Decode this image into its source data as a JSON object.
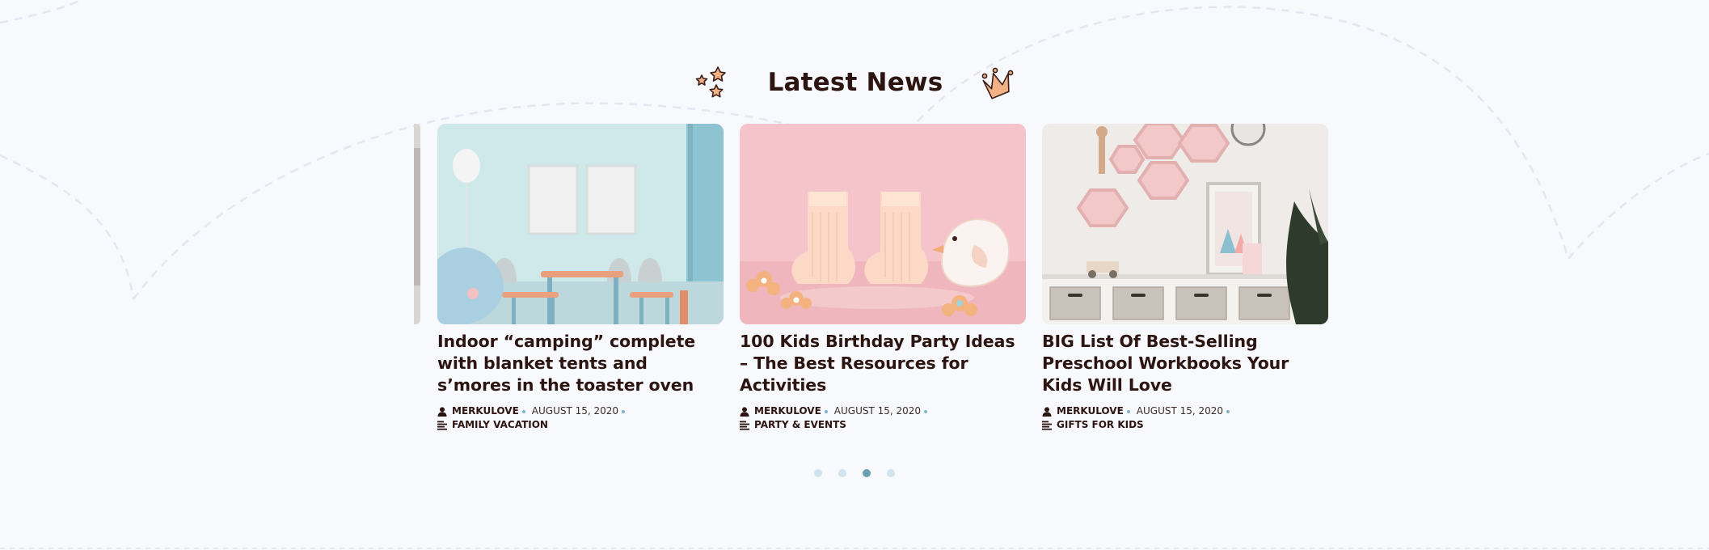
{
  "section": {
    "title": "Latest News",
    "left_icon": "stars-icon",
    "right_icon": "crown-icon"
  },
  "posts": [
    {
      "title": "Indoor “camping” complete with blanket tents and s’mores in the toaster oven",
      "author": "MERKULOVE",
      "date": "AUGUST 15, 2020",
      "category": "FAMILY VACATION"
    },
    {
      "title": "100 Kids Birthday Party Ideas – The Best Resources for Activities",
      "author": "MERKULOVE",
      "date": "AUGUST 15, 2020",
      "category": "PARTY & EVENTS"
    },
    {
      "title": "BIG List Of Best-Selling Preschool Workbooks Your Kids Will Love",
      "author": "MERKULOVE",
      "date": "AUGUST 15, 2020",
      "category": "GIFTS FOR KIDS"
    }
  ],
  "pagination": {
    "total": 4,
    "active_index": 3
  },
  "colors": {
    "background": "#f8f9fd",
    "heading": "#2c1410",
    "accent_dot": "#7ab7c8",
    "pagination_active": "#6a9fb6",
    "pagination_inactive": "#cfe4ec"
  }
}
